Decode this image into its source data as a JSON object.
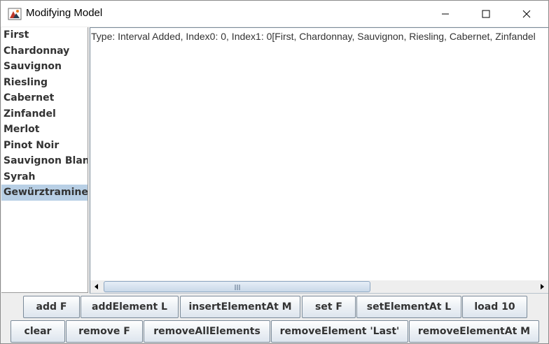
{
  "window": {
    "title": "Modifying Model",
    "controls": {
      "minimize": "minimize",
      "maximize": "maximize",
      "close": "close"
    }
  },
  "list": {
    "items": [
      "First",
      "Chardonnay",
      "Sauvignon",
      "Riesling",
      "Cabernet",
      "Zinfandel",
      "Merlot",
      "Pinot Noir",
      "Sauvignon Blanc",
      "Syrah",
      "Gewürztraminer"
    ],
    "selected_index": 10
  },
  "log": {
    "lines": [
      "Type: Interval Added, Index0: 0, Index1: 0[First, Chardonnay, Sauvignon, Riesling, Cabernet, Zinfandel"
    ]
  },
  "buttons": {
    "row1": [
      "add F",
      "addElement L",
      "insertElementAt M",
      "set F",
      "setElementAt L",
      "load 10"
    ],
    "row2": [
      "clear",
      "remove F",
      "removeAllElements",
      "removeElement 'Last'",
      "removeElementAt M"
    ]
  },
  "colors": {
    "selection": "#b8cfe5",
    "button_border": "#7a8a99",
    "text": "#333333"
  }
}
